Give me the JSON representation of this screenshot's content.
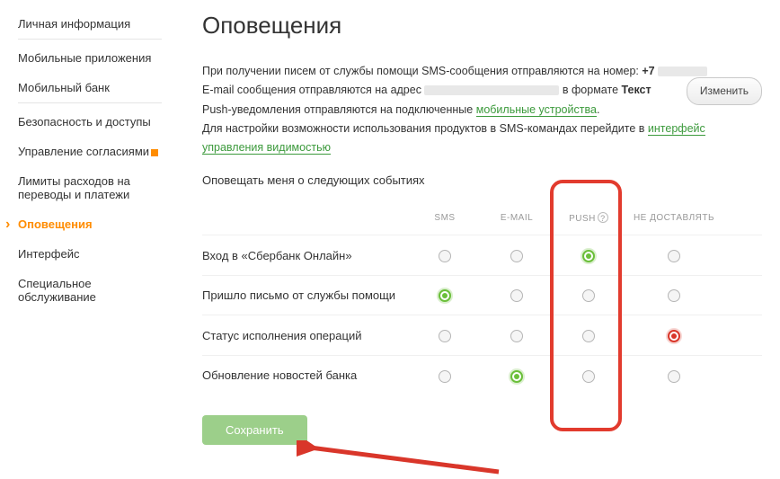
{
  "sidebar": {
    "items": [
      {
        "label": "Личная информация"
      },
      {
        "label": "Мобильные приложения"
      },
      {
        "label": "Мобильный банк"
      },
      {
        "label": "Безопасность и доступы"
      },
      {
        "label": "Управление согласиями"
      },
      {
        "label": "Лимиты расходов на переводы и платежи"
      },
      {
        "label": "Оповещения"
      },
      {
        "label": "Интерфейс"
      },
      {
        "label": "Специальное обслуживание"
      }
    ]
  },
  "page": {
    "title": "Оповещения",
    "info_line1_a": "При получении писем от службы помощи SMS-сообщения отправляются на номер: ",
    "info_line1_b": "+7",
    "info_line2_a": "E-mail сообщения отправляются на адрес ",
    "info_line2_b": " в формате ",
    "info_line2_c": "Текст",
    "change_btn": "Изменить",
    "info_line3_a": "Push-уведомления отправляются на подключенные ",
    "info_line3_link": "мобильные устройства",
    "info_line3_b": ".",
    "info_line4_a": "Для настройки возможности использования продуктов в SMS-командах перейдите в ",
    "info_line4_link": "интерфейс управления видимостью",
    "subtitle": "Оповещать меня о следующих событиях",
    "columns": {
      "sms": "SMS",
      "email": "E-MAIL",
      "push": "PUSH",
      "none": "НЕ ДОСТАВЛЯТЬ"
    },
    "rows": [
      {
        "label": "Вход в «Сбербанк Онлайн»",
        "selected": "push",
        "style": "green"
      },
      {
        "label": "Пришло письмо от службы помощи",
        "selected": "sms",
        "style": "green"
      },
      {
        "label": "Статус исполнения операций",
        "selected": "none",
        "style": "red"
      },
      {
        "label": "Обновление новостей банка",
        "selected": "email",
        "style": "green"
      }
    ],
    "save_btn": "Сохранить"
  }
}
